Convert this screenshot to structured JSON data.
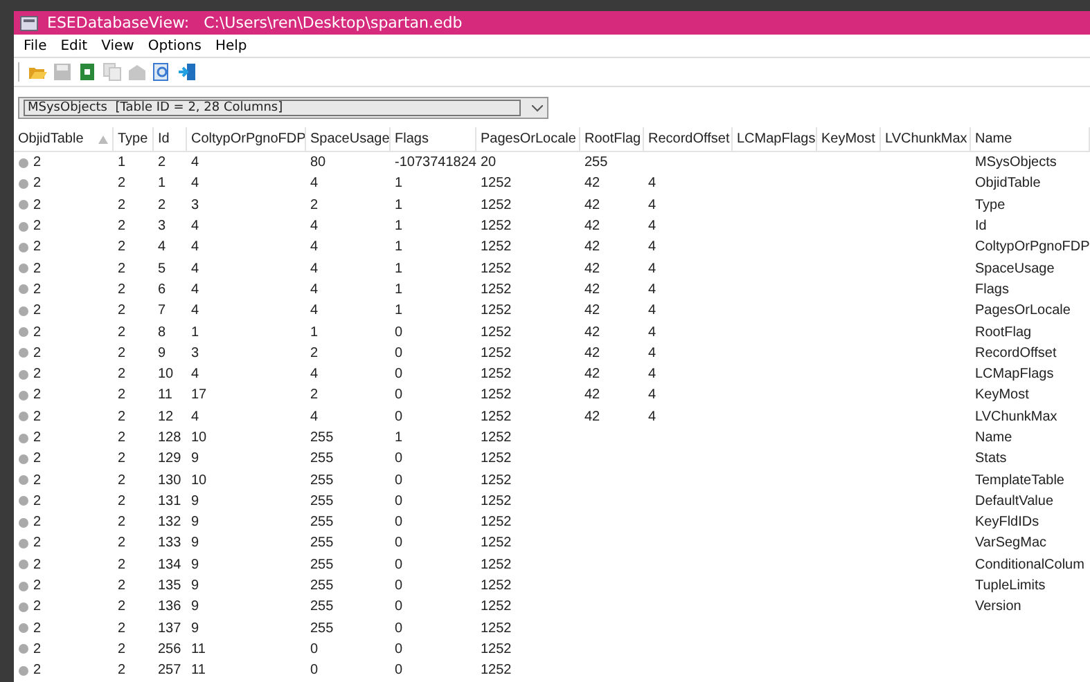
{
  "window": {
    "title": "ESEDatabaseView:   C:\\Users\\ren\\Desktop\\spartan.edb"
  },
  "menu": [
    "File",
    "Edit",
    "View",
    "Options",
    "Help"
  ],
  "toolbar": [
    {
      "kind": "open"
    },
    {
      "kind": "save",
      "disabled": true
    },
    {
      "kind": "refresh"
    },
    {
      "kind": "copy",
      "disabled": true
    },
    {
      "kind": "properties",
      "disabled": true
    },
    {
      "kind": "find"
    },
    {
      "kind": "exit"
    }
  ],
  "table_selector": {
    "value": "MSysObjects  [Table ID = 2, 28 Columns]"
  },
  "table": {
    "columns": [
      {
        "label": "ObjidTable",
        "sorted": true
      },
      {
        "label": "Type"
      },
      {
        "label": "Id"
      },
      {
        "label": "ColtypOrPgnoFDP"
      },
      {
        "label": "SpaceUsage"
      },
      {
        "label": "Flags"
      },
      {
        "label": "PagesOrLocale"
      },
      {
        "label": "RootFlag"
      },
      {
        "label": "RecordOffset"
      },
      {
        "label": "LCMapFlags"
      },
      {
        "label": "KeyMost"
      },
      {
        "label": "LVChunkMax"
      },
      {
        "label": "Name"
      }
    ],
    "rows": [
      [
        "2",
        "1",
        "2",
        "4",
        "80",
        "-1073741824",
        "20",
        "255",
        "",
        "",
        "",
        "",
        "MSysObjects"
      ],
      [
        "2",
        "2",
        "1",
        "4",
        "4",
        "1",
        "1252",
        "42",
        "4",
        "",
        "",
        "",
        "ObjidTable"
      ],
      [
        "2",
        "2",
        "2",
        "3",
        "2",
        "1",
        "1252",
        "42",
        "4",
        "",
        "",
        "",
        "Type"
      ],
      [
        "2",
        "2",
        "3",
        "4",
        "4",
        "1",
        "1252",
        "42",
        "4",
        "",
        "",
        "",
        "Id"
      ],
      [
        "2",
        "2",
        "4",
        "4",
        "4",
        "1",
        "1252",
        "42",
        "4",
        "",
        "",
        "",
        "ColtypOrPgnoFDP"
      ],
      [
        "2",
        "2",
        "5",
        "4",
        "4",
        "1",
        "1252",
        "42",
        "4",
        "",
        "",
        "",
        "SpaceUsage"
      ],
      [
        "2",
        "2",
        "6",
        "4",
        "4",
        "1",
        "1252",
        "42",
        "4",
        "",
        "",
        "",
        "Flags"
      ],
      [
        "2",
        "2",
        "7",
        "4",
        "4",
        "1",
        "1252",
        "42",
        "4",
        "",
        "",
        "",
        "PagesOrLocale"
      ],
      [
        "2",
        "2",
        "8",
        "1",
        "1",
        "0",
        "1252",
        "42",
        "4",
        "",
        "",
        "",
        "RootFlag"
      ],
      [
        "2",
        "2",
        "9",
        "3",
        "2",
        "0",
        "1252",
        "42",
        "4",
        "",
        "",
        "",
        "RecordOffset"
      ],
      [
        "2",
        "2",
        "10",
        "4",
        "4",
        "0",
        "1252",
        "42",
        "4",
        "",
        "",
        "",
        "LCMapFlags"
      ],
      [
        "2",
        "2",
        "11",
        "17",
        "2",
        "0",
        "1252",
        "42",
        "4",
        "",
        "",
        "",
        "KeyMost"
      ],
      [
        "2",
        "2",
        "12",
        "4",
        "4",
        "0",
        "1252",
        "42",
        "4",
        "",
        "",
        "",
        "LVChunkMax"
      ],
      [
        "2",
        "2",
        "128",
        "10",
        "255",
        "1",
        "1252",
        "",
        "",
        "",
        "",
        "",
        "Name"
      ],
      [
        "2",
        "2",
        "129",
        "9",
        "255",
        "0",
        "1252",
        "",
        "",
        "",
        "",
        "",
        "Stats"
      ],
      [
        "2",
        "2",
        "130",
        "10",
        "255",
        "0",
        "1252",
        "",
        "",
        "",
        "",
        "",
        "TemplateTable"
      ],
      [
        "2",
        "2",
        "131",
        "9",
        "255",
        "0",
        "1252",
        "",
        "",
        "",
        "",
        "",
        "DefaultValue"
      ],
      [
        "2",
        "2",
        "132",
        "9",
        "255",
        "0",
        "1252",
        "",
        "",
        "",
        "",
        "",
        "KeyFldIDs"
      ],
      [
        "2",
        "2",
        "133",
        "9",
        "255",
        "0",
        "1252",
        "",
        "",
        "",
        "",
        "",
        "VarSegMac"
      ],
      [
        "2",
        "2",
        "134",
        "9",
        "255",
        "0",
        "1252",
        "",
        "",
        "",
        "",
        "",
        "ConditionalColum"
      ],
      [
        "2",
        "2",
        "135",
        "9",
        "255",
        "0",
        "1252",
        "",
        "",
        "",
        "",
        "",
        "TupleLimits"
      ],
      [
        "2",
        "2",
        "136",
        "9",
        "255",
        "0",
        "1252",
        "",
        "",
        "",
        "",
        "",
        "Version"
      ],
      [
        "2",
        "2",
        "137",
        "9",
        "255",
        "0",
        "1252",
        "",
        "",
        "",
        "",
        ""
      ],
      [
        "2",
        "2",
        "256",
        "11",
        "0",
        "0",
        "1252",
        "",
        "",
        "",
        "",
        ""
      ],
      [
        "2",
        "2",
        "257",
        "11",
        "0",
        "0",
        "1252",
        "",
        "",
        "",
        "",
        ""
      ]
    ]
  }
}
